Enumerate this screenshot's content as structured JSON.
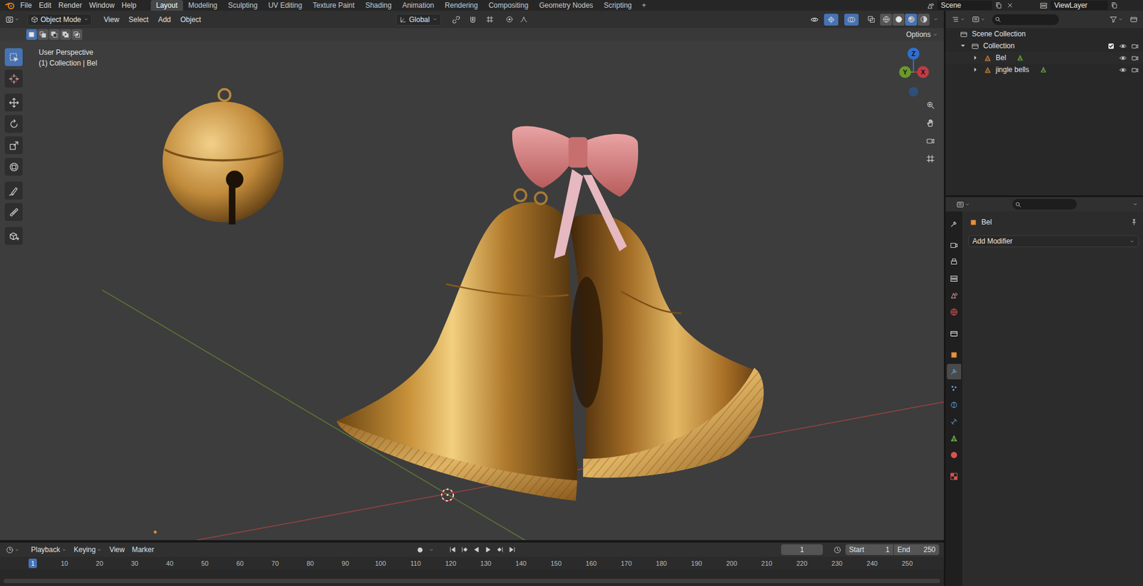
{
  "topbar": {
    "menus": [
      "File",
      "Edit",
      "Render",
      "Window",
      "Help"
    ],
    "workspaces": [
      {
        "label": "Layout",
        "selected": true
      },
      {
        "label": "Modeling",
        "selected": false
      },
      {
        "label": "Sculpting",
        "selected": false
      },
      {
        "label": "UV Editing",
        "selected": false
      },
      {
        "label": "Texture Paint",
        "selected": false
      },
      {
        "label": "Shading",
        "selected": false
      },
      {
        "label": "Animation",
        "selected": false
      },
      {
        "label": "Rendering",
        "selected": false
      },
      {
        "label": "Compositing",
        "selected": false
      },
      {
        "label": "Geometry Nodes",
        "selected": false
      },
      {
        "label": "Scripting",
        "selected": false
      }
    ],
    "add_workspace": "+",
    "scene": "Scene",
    "view_layer": "ViewLayer"
  },
  "viewport": {
    "mode": "Object Mode",
    "menus": [
      "View",
      "Select",
      "Add",
      "Object"
    ],
    "orientation": "Global",
    "options": "Options",
    "view_name": "User Perspective",
    "context": "(1) Collection | Bel",
    "shading": [
      {
        "kind": "wireframe",
        "selected": false
      },
      {
        "kind": "solid",
        "selected": false
      },
      {
        "kind": "material",
        "selected": true
      },
      {
        "kind": "rendered",
        "selected": false
      }
    ],
    "select_modes": [
      {
        "kind": "set",
        "selected": true
      },
      {
        "kind": "extend",
        "selected": false
      },
      {
        "kind": "subtract",
        "selected": false
      },
      {
        "kind": "difference",
        "selected": false
      },
      {
        "kind": "intersect",
        "selected": false
      }
    ],
    "tools": [
      {
        "kind": "select",
        "selected": true
      },
      {
        "kind": "cursor",
        "selected": false
      },
      {
        "kind": "move",
        "selected": false
      },
      {
        "kind": "rotate",
        "selected": false
      },
      {
        "kind": "scale",
        "selected": false
      },
      {
        "kind": "transform",
        "selected": false
      },
      {
        "kind": "annotate",
        "selected": false
      },
      {
        "kind": "measure",
        "selected": false
      },
      {
        "kind": "add-cube",
        "selected": false
      }
    ],
    "gizmo": [
      {
        "label": "Z",
        "color": "#2f6fcf"
      },
      {
        "label": "Y",
        "color": "#6a9a2a"
      },
      {
        "label": "X",
        "color": "#c23a44"
      }
    ]
  },
  "timeline": {
    "menus": [
      {
        "label": "Playback",
        "kind": "dropdown"
      },
      {
        "label": "Keying",
        "kind": "dropdown"
      },
      {
        "label": "View",
        "kind": "menu"
      },
      {
        "label": "Marker",
        "kind": "menu"
      }
    ],
    "current_frame": "1",
    "start_label": "Start",
    "start": "1",
    "end_label": "End",
    "end": "250",
    "ruler": [
      {
        "label": "1",
        "selected": true
      },
      {
        "label": "10",
        "selected": false
      },
      {
        "label": "20",
        "selected": false
      },
      {
        "label": "30",
        "selected": false
      },
      {
        "label": "40",
        "selected": false
      },
      {
        "label": "50",
        "selected": false
      },
      {
        "label": "60",
        "selected": false
      },
      {
        "label": "70",
        "selected": false
      },
      {
        "label": "80",
        "selected": false
      },
      {
        "label": "90",
        "selected": false
      },
      {
        "label": "100",
        "selected": false
      },
      {
        "label": "110",
        "selected": false
      },
      {
        "label": "120",
        "selected": false
      },
      {
        "label": "130",
        "selected": false
      },
      {
        "label": "140",
        "selected": false
      },
      {
        "label": "150",
        "selected": false
      },
      {
        "label": "160",
        "selected": false
      },
      {
        "label": "170",
        "selected": false
      },
      {
        "label": "180",
        "selected": false
      },
      {
        "label": "190",
        "selected": false
      },
      {
        "label": "200",
        "selected": false
      },
      {
        "label": "210",
        "selected": false
      },
      {
        "label": "220",
        "selected": false
      },
      {
        "label": "230",
        "selected": false
      },
      {
        "label": "240",
        "selected": false
      },
      {
        "label": "250",
        "selected": false
      }
    ]
  },
  "outliner": {
    "root": "Scene Collection",
    "rows": [
      {
        "label": "Collection",
        "kind": "collection",
        "depth": 0,
        "expanded": true,
        "visible": true,
        "excluded": false
      },
      {
        "label": "Bel",
        "kind": "mesh",
        "depth": 1,
        "expanded": false,
        "visible": true,
        "excluded": false
      },
      {
        "label": "jingle bells",
        "kind": "mesh",
        "depth": 1,
        "expanded": false,
        "visible": true,
        "excluded": false
      }
    ]
  },
  "properties": {
    "tabs": [
      {
        "kind": "tool",
        "selected": false
      },
      {
        "kind": "render",
        "selected": false
      },
      {
        "kind": "output",
        "selected": false
      },
      {
        "kind": "view-layer",
        "selected": false
      },
      {
        "kind": "scene",
        "selected": false
      },
      {
        "kind": "world",
        "selected": false
      },
      {
        "kind": "collection",
        "selected": false
      },
      {
        "kind": "object",
        "selected": false
      },
      {
        "kind": "modifiers",
        "selected": true
      },
      {
        "kind": "particles",
        "selected": false
      },
      {
        "kind": "physics",
        "selected": false
      },
      {
        "kind": "constraints",
        "selected": false
      },
      {
        "kind": "data",
        "selected": false
      },
      {
        "kind": "material",
        "selected": false
      },
      {
        "kind": "texture",
        "selected": false
      }
    ],
    "object": "Bel",
    "add_modifier": "Add Modifier"
  }
}
